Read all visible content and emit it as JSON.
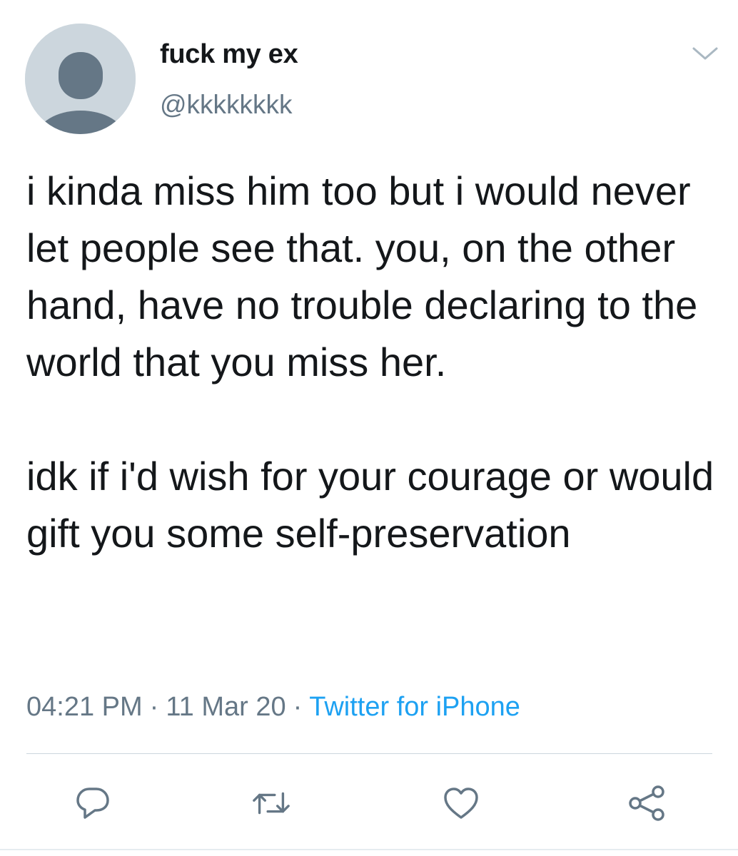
{
  "user": {
    "display_name": "fuck my ex",
    "handle": "@kkkkkkkk"
  },
  "tweet": {
    "text": "i kinda miss him too but i would never let people see that. you, on the other hand, have no trouble declaring to the world that you miss her.\n\nidk if i'd wish for your courage or would gift you some self-preservation",
    "time": "04:21 PM",
    "date": "11 Mar 20",
    "separator": "·",
    "source": "Twitter for iPhone"
  },
  "icons": {
    "avatar": "default-avatar-icon",
    "menu": "chevron-down-icon",
    "reply": "reply-icon",
    "retweet": "retweet-icon",
    "like": "heart-icon",
    "share": "share-icon"
  },
  "colors": {
    "text": "#14171a",
    "secondary": "#657786",
    "link": "#1da1f2",
    "avatar_bg": "#ccd6dd",
    "avatar_fg": "#657786",
    "divider": "#ccd6dd"
  }
}
